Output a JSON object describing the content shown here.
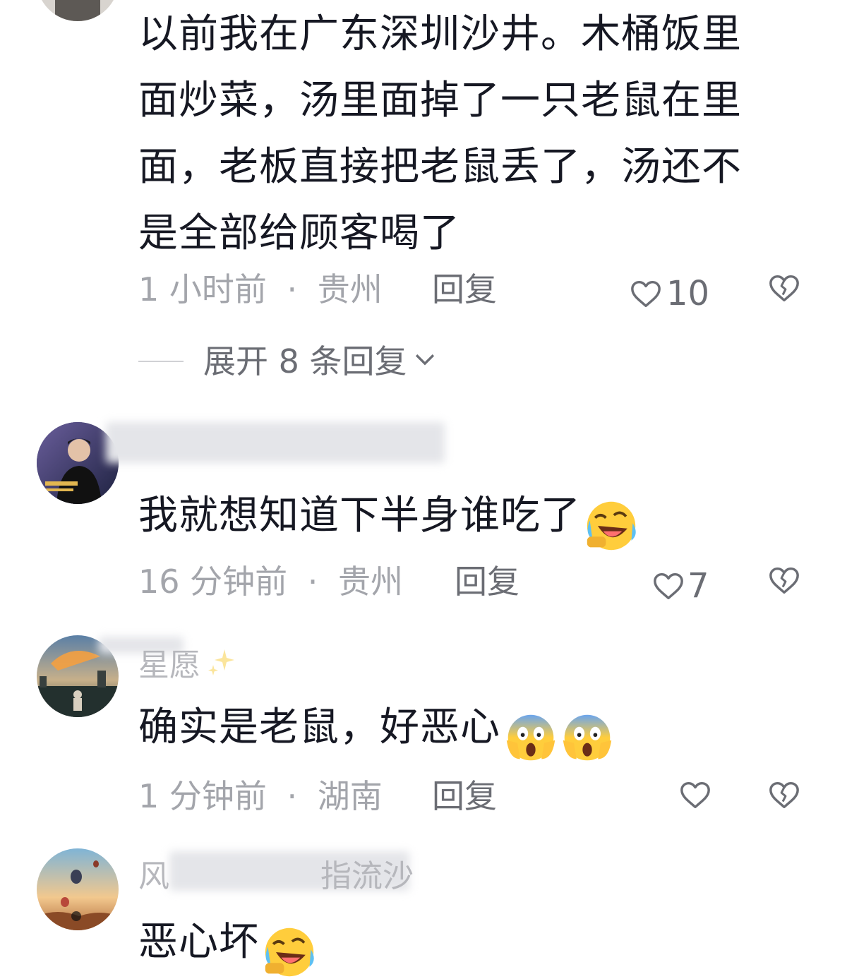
{
  "comments": [
    {
      "text_lines": [
        "以前我在广东深圳沙井。木桶饭里",
        "面炒菜，汤里面掉了一只老鼠在里",
        "面，老板直接把老鼠丢了，汤还不",
        "是全部给顾客喝了"
      ],
      "time": "1 小时前",
      "location": "贵州",
      "reply_label": "回复",
      "likes": "10",
      "expand_label": "展开 8 条回复"
    },
    {
      "username": "",
      "text": "我就想知道下半身谁吃了",
      "emoji": "rofl-emoji",
      "time": "16 分钟前",
      "location": "贵州",
      "reply_label": "回复",
      "likes": "7"
    },
    {
      "username": "星愿",
      "text": "确实是老鼠，好恶心",
      "emoji": "scream-emoji",
      "time": "1 分钟前",
      "location": "湖南",
      "reply_label": "回复",
      "likes": ""
    },
    {
      "username_start": "风",
      "username_end": "指流沙",
      "text": "恶心坏",
      "emoji": "rofl-emoji"
    }
  ],
  "separator": "·",
  "colors": {
    "text": "#161823",
    "meta": "#a3a5ab",
    "reply": "#6b6d74"
  }
}
